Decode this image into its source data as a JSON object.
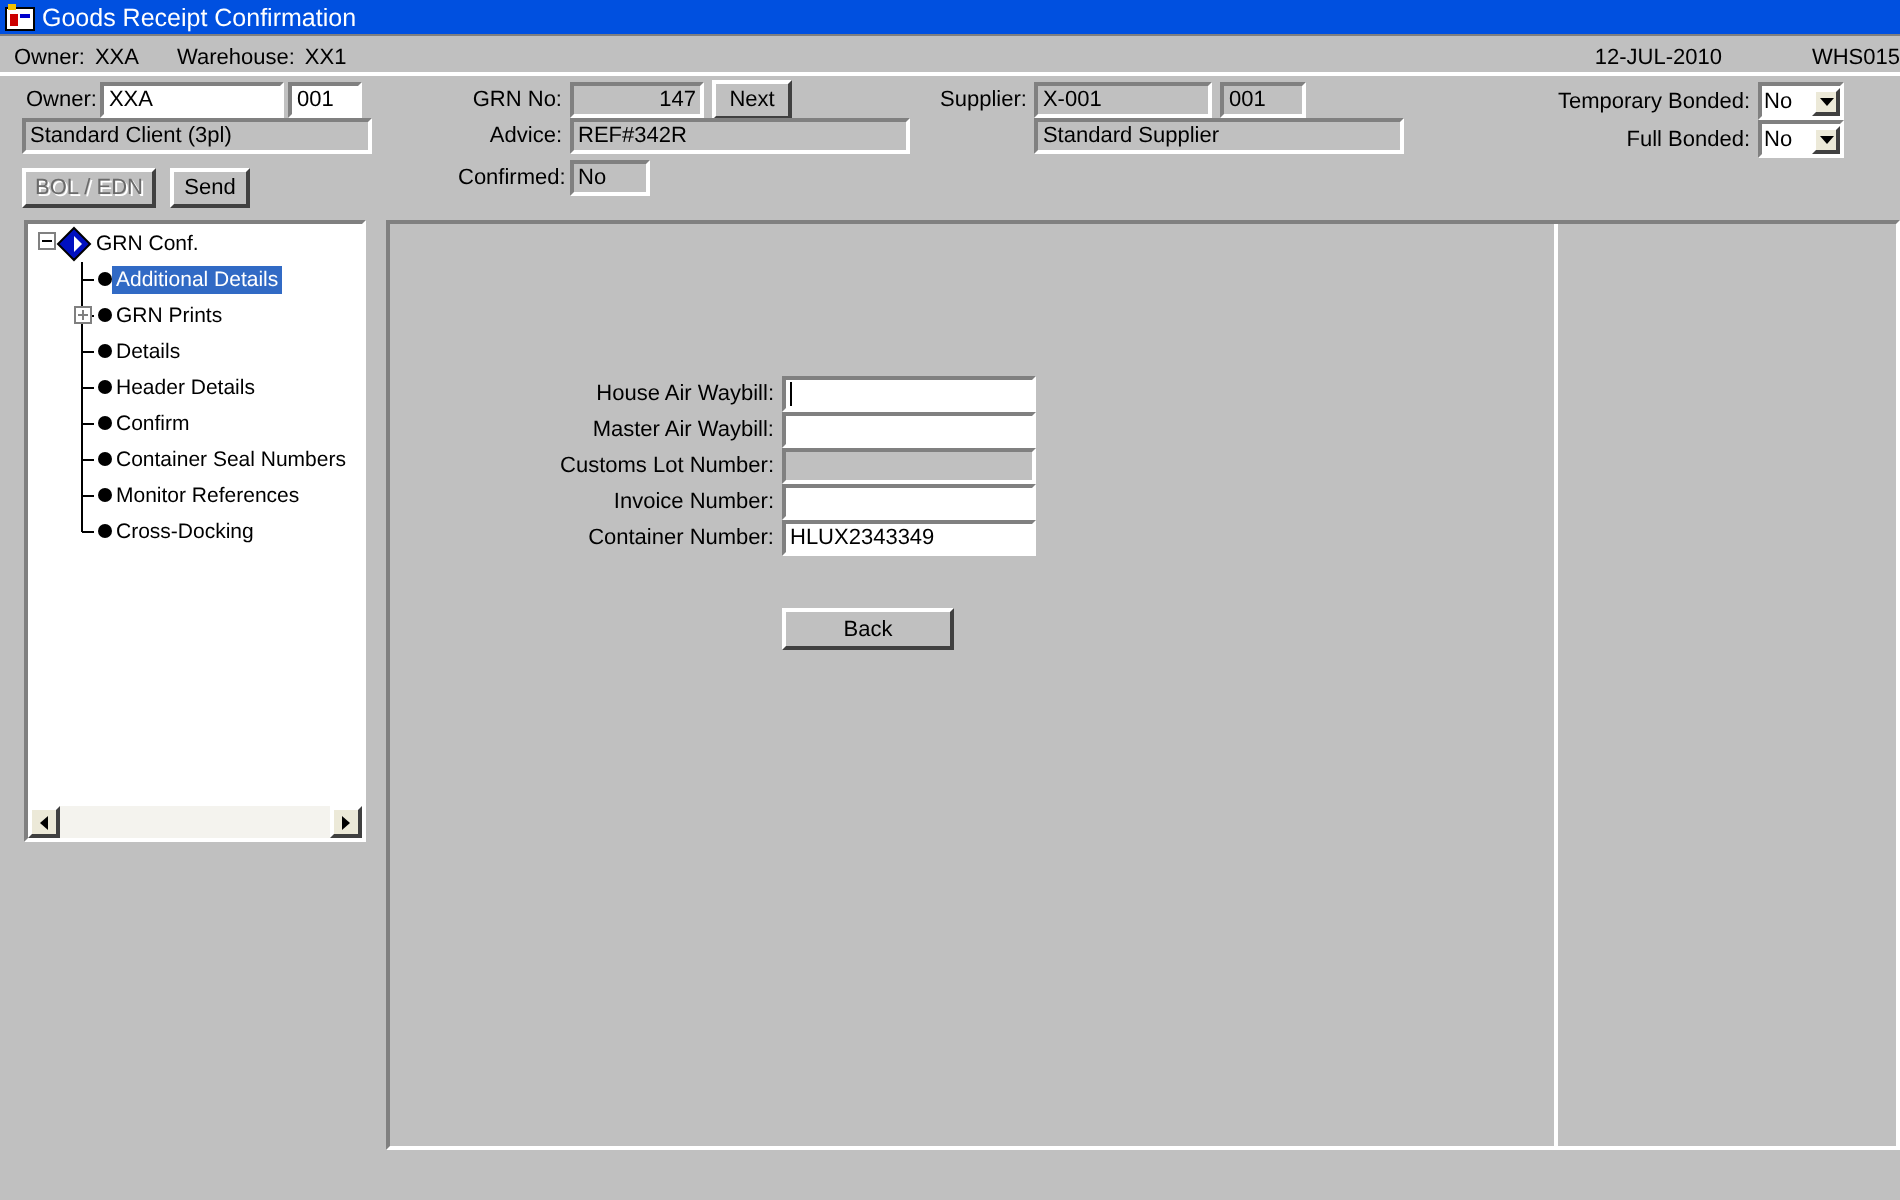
{
  "window": {
    "title": "Goods Receipt Confirmation"
  },
  "info_bar": {
    "owner_label": "Owner:",
    "owner": "XXA",
    "warehouse_label": "Warehouse:",
    "warehouse": "XX1",
    "date": "12-JUL-2010",
    "user": "WHS015"
  },
  "header": {
    "owner": {
      "label": "Owner:",
      "code": {
        "value": "XXA",
        "editable": true
      },
      "suffix": {
        "value": "001",
        "editable": true
      },
      "name": {
        "value": "Standard Client (3pl)",
        "editable": false
      }
    },
    "buttons": [
      {
        "label": "BOL / EDN",
        "disabled": true
      },
      {
        "label": "Send",
        "disabled": false
      }
    ],
    "grn": [
      {
        "label": "GRN No:",
        "value": "147",
        "editable": false,
        "kind": "number",
        "button": "Next"
      },
      {
        "label": "Advice:",
        "value": "REF#342R",
        "editable": false,
        "kind": "text"
      },
      {
        "label": "Confirmed:",
        "value": "No",
        "editable": false,
        "kind": "text"
      }
    ],
    "supplier": {
      "label": "Supplier:",
      "code": {
        "value": "X-001",
        "editable": false
      },
      "suffix": {
        "value": "001",
        "editable": false
      },
      "name": {
        "value": "Standard Supplier",
        "editable": false
      }
    },
    "bonded": [
      {
        "label": "Temporary Bonded:",
        "value": "No"
      },
      {
        "label": "Full Bonded:",
        "value": "No"
      }
    ]
  },
  "tree": {
    "label": "GRN Conf.",
    "expanded": true,
    "children": [
      {
        "label": "Additional Details",
        "selected": true,
        "expandable": false
      },
      {
        "label": "GRN Prints",
        "selected": false,
        "expandable": true
      },
      {
        "label": "Details",
        "selected": false,
        "expandable": false
      },
      {
        "label": "Header Details",
        "selected": false,
        "expandable": false
      },
      {
        "label": "Confirm",
        "selected": false,
        "expandable": false
      },
      {
        "label": "Container Seal Numbers",
        "selected": false,
        "expandable": false
      },
      {
        "label": "Monitor References",
        "selected": false,
        "expandable": false
      },
      {
        "label": "Cross-Docking",
        "selected": false,
        "expandable": false
      }
    ]
  },
  "form": {
    "fields": [
      {
        "label": "House Air Waybill:",
        "editable": true,
        "focused": true
      },
      {
        "label": "Master Air Waybill:",
        "editable": true,
        "focused": false
      },
      {
        "label": "Customs Lot Number:",
        "editable": false,
        "focused": false
      },
      {
        "label": "Invoice Number:",
        "editable": true,
        "focused": false
      },
      {
        "label": "Container Number:",
        "value": "HLUX2343349",
        "editable": true,
        "focused": false
      }
    ],
    "button": "Back"
  }
}
